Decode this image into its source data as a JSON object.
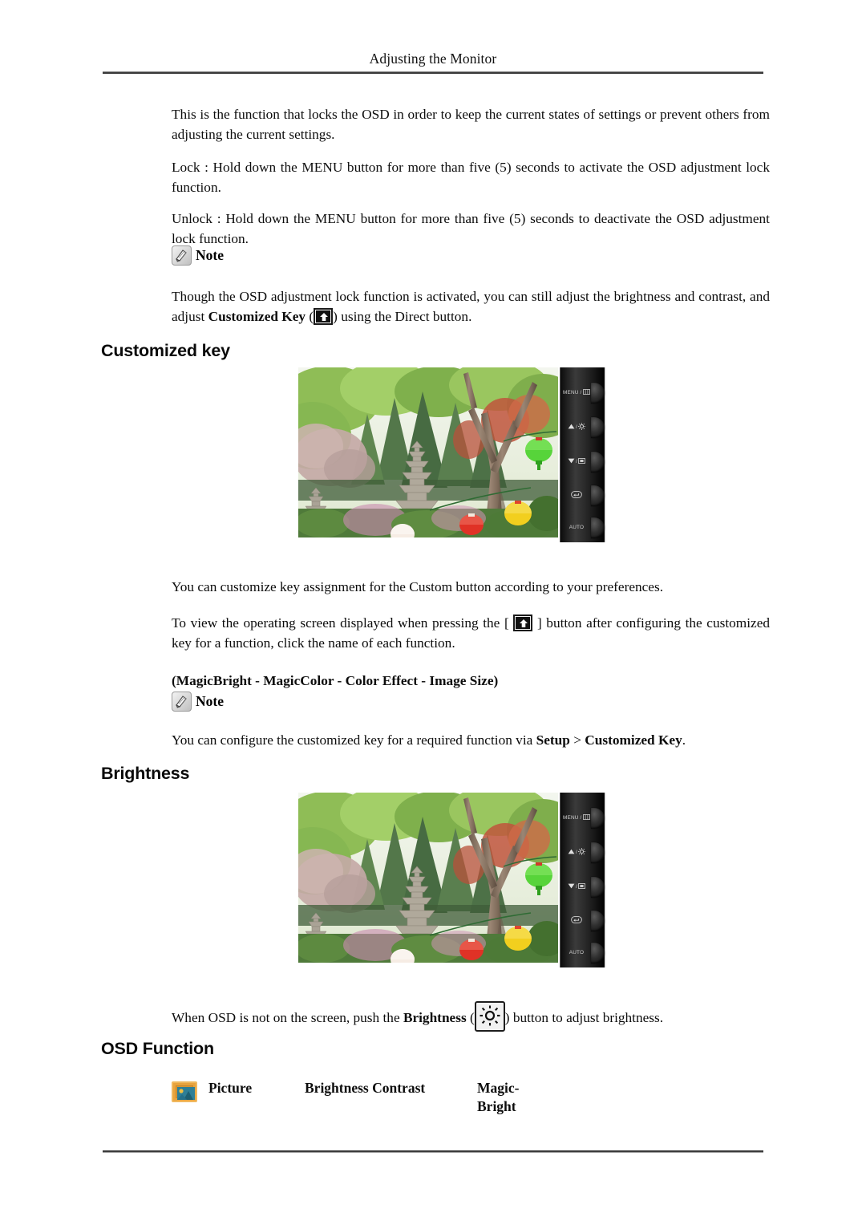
{
  "page": {
    "header_title": "Adjusting the Monitor"
  },
  "content": {
    "para_lock_intro": "This is the function that locks the OSD in order to keep the current states of settings or prevent others from adjusting the current settings.",
    "para_lock": "Lock : Hold down the MENU button for more than five (5) seconds to activate the OSD adjustment lock function.",
    "para_unlock": "Unlock : Hold down the MENU button for more than five (5) seconds to deactivate the OSD adjustment lock function.",
    "note_label": "Note",
    "para_note_1_a": "Though the OSD adjustment lock function is activated, you can still adjust the brightness and contrast, and adjust ",
    "para_note_1_bold": "Customized Key",
    "para_note_1_b": " (",
    "para_note_1_c": ") using the Direct button.",
    "para_customize": "You can customize key assignment for the Custom button according to your preferences.",
    "para_toview_a": "To view the operating screen displayed when pressing the [ ",
    "para_toview_b": " ] button after configuring the customized key for a function, click the name of each function.",
    "para_magic_list": "(MagicBright - MagicColor - Color Effect - Image Size)",
    "note_label_2": "Note",
    "para_configure_a": "You can configure the customized key for a required function via ",
    "para_configure_bold1": "Setup",
    "para_configure_b": " > ",
    "para_configure_bold2": "Customized Key",
    "para_configure_c": ".",
    "para_brightness_a": "When OSD is not on the screen, push the ",
    "para_brightness_bold": "Brightness",
    "para_brightness_b": " (",
    "para_brightness_c": ") button to adjust brightness."
  },
  "headings": {
    "customized_key": "Customized key",
    "brightness": "Brightness",
    "osd_function": "OSD Function"
  },
  "monitor_panel": {
    "buttons": [
      {
        "label": "MENU /",
        "glyph": "menu-grid-icon"
      },
      {
        "label": "/",
        "glyph": "up-brightness-icon"
      },
      {
        "label": "/",
        "glyph": "down-magicbright-icon"
      },
      {
        "label": "",
        "glyph": "enter-source-icon"
      },
      {
        "label": "AUTO",
        "glyph": ""
      }
    ]
  },
  "osd_function_table": {
    "icon_name": "picture-icon",
    "picture": "Picture",
    "brightness_contrast": "Brightness  Contrast",
    "magic_bright_line1": "Magic-",
    "magic_bright_line2": "Bright"
  },
  "colors": {
    "rule": "#3a3a3a",
    "picture_icon_border": "#f0b85e",
    "picture_icon_fill": "#e8a33d",
    "text": "#0d0d0d"
  }
}
